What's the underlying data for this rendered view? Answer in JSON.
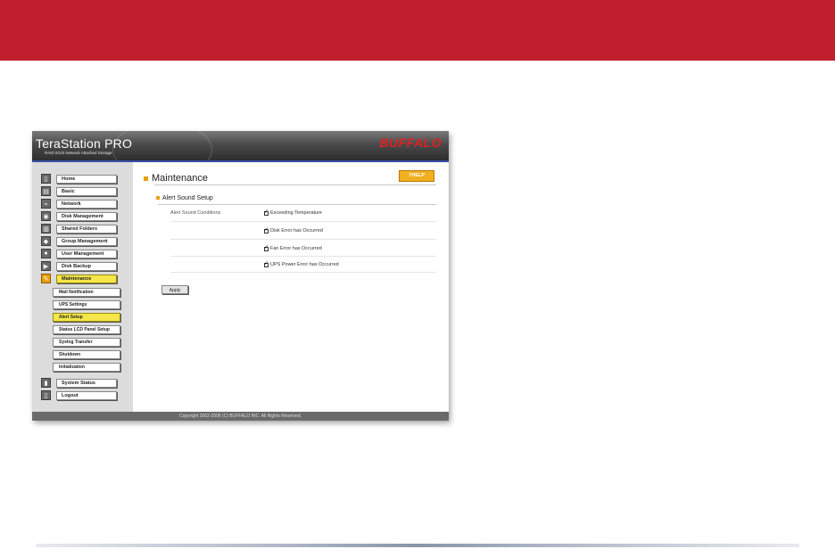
{
  "app": {
    "logo": "TeraStation PRO",
    "subtitle": "RAID 0/1/5 Network Attached Storage",
    "brand": "BUFFALO"
  },
  "sidebar": {
    "items": [
      {
        "label": "Home",
        "icon": "home-icon"
      },
      {
        "label": "Basic",
        "icon": "basic-icon"
      },
      {
        "label": "Network",
        "icon": "network-icon"
      },
      {
        "label": "Disk Management",
        "icon": "disk-icon"
      },
      {
        "label": "Shared Folders",
        "icon": "folder-icon"
      },
      {
        "label": "Group Management",
        "icon": "group-icon"
      },
      {
        "label": "User Management",
        "icon": "user-icon"
      },
      {
        "label": "Disk Backup",
        "icon": "backup-icon"
      },
      {
        "label": "Maintenance",
        "icon": "tools-icon",
        "active": true
      }
    ],
    "subitems": [
      {
        "label": "Mail Notification"
      },
      {
        "label": "UPS Settings"
      },
      {
        "label": "Alert Setup",
        "active": true
      },
      {
        "label": "Status LCD Panel Setup"
      },
      {
        "label": "Syslog Transfer"
      },
      {
        "label": "Shutdown"
      },
      {
        "label": "Initialization"
      }
    ],
    "bottom_items": [
      {
        "label": "System Status",
        "icon": "status-icon"
      },
      {
        "label": "Logout",
        "icon": "logout-icon"
      }
    ]
  },
  "main": {
    "title": "Maintenance",
    "help_label": "?HELP",
    "section_title": "Alert Sound Setup",
    "conditions_label": "Alert Sound Conditions",
    "options": [
      {
        "label": "Exceeding Temperature",
        "checked": true
      },
      {
        "label": "Disk Error has Occurred",
        "checked": true
      },
      {
        "label": "Fan Error has Occurred",
        "checked": true
      },
      {
        "label": "UPS Power Error has Occurred",
        "checked": true
      }
    ],
    "apply_label": "Apply"
  },
  "footer": {
    "copyright": "Copyright 2002-2006 (C) BUFFALO INC. All Rights Reserved."
  },
  "colors": {
    "band": "#c0202e",
    "accent": "#f5e64a",
    "brand": "#e02020"
  }
}
